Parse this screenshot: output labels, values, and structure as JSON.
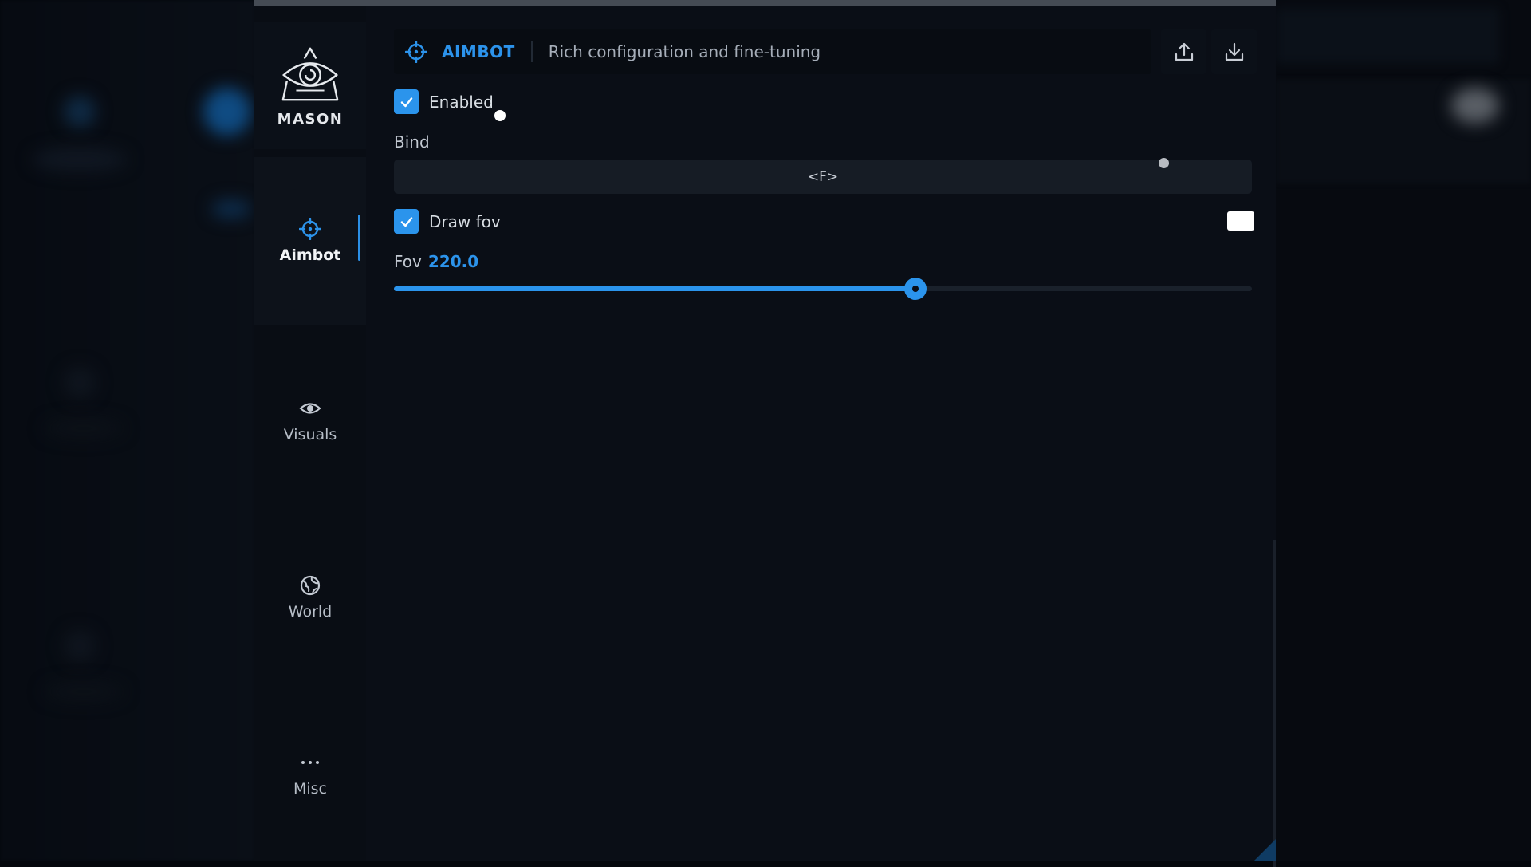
{
  "brand": {
    "name": "MASON"
  },
  "sidebar": {
    "items": [
      {
        "label": "Aimbot",
        "icon": "crosshair-icon",
        "active": true
      },
      {
        "label": "Visuals",
        "icon": "eye-icon",
        "active": false
      },
      {
        "label": "World",
        "icon": "globe-icon",
        "active": false
      },
      {
        "label": "Misc",
        "icon": "more-dots-icon",
        "active": false
      }
    ]
  },
  "header": {
    "title": "AIMBOT",
    "subtitle": "Rich configuration and fine-tuning",
    "icon": "crosshair-icon",
    "actions": [
      {
        "icon": "upload-icon"
      },
      {
        "icon": "download-icon"
      }
    ]
  },
  "settings": {
    "enabled": {
      "label": "Enabled",
      "checked": true
    },
    "bind": {
      "label": "Bind",
      "value": "<F>"
    },
    "draw_fov": {
      "label": "Draw fov",
      "checked": true,
      "color": "#ffffff"
    },
    "fov": {
      "label": "Fov",
      "value_text": "220.0",
      "value": 220.0,
      "fill_fraction": 0.608
    }
  },
  "colors": {
    "accent": "#2b94ec",
    "panel": "#0a0e16",
    "sidebar": "#090d14"
  }
}
